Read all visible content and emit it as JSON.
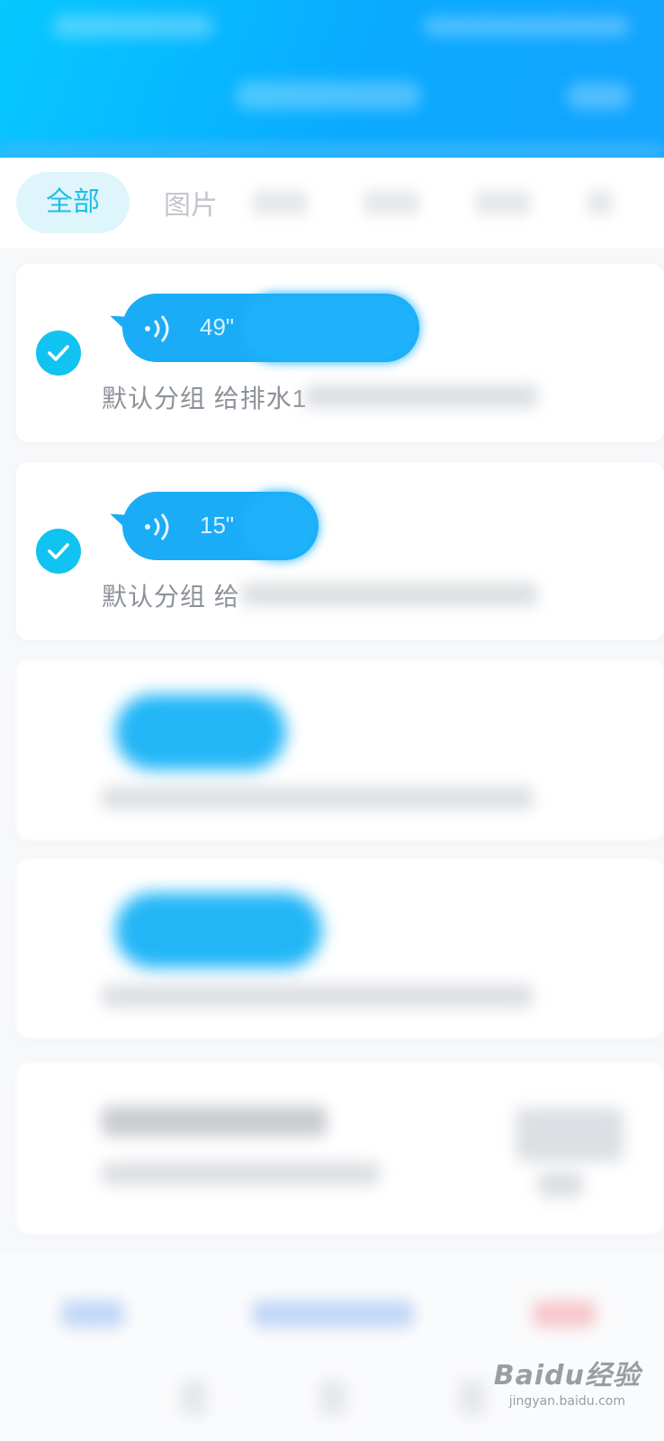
{
  "header": {
    "background_color": "#0aaaff"
  },
  "tabs": [
    {
      "label": "全部",
      "active": true
    },
    {
      "label": "图片",
      "active": false
    }
  ],
  "items": [
    {
      "duration": "49\"",
      "meta": "默认分组 给排水1",
      "checked": true
    },
    {
      "duration": "15\"",
      "meta": "默认分组 给",
      "checked": true
    }
  ],
  "colors": {
    "accent": "#11c3f0",
    "bubble": "#1aacf6",
    "tab_active_bg": "#dff5fc"
  },
  "watermark": {
    "logo": "Baidu经验",
    "sub": "jingyan.baidu.com"
  }
}
